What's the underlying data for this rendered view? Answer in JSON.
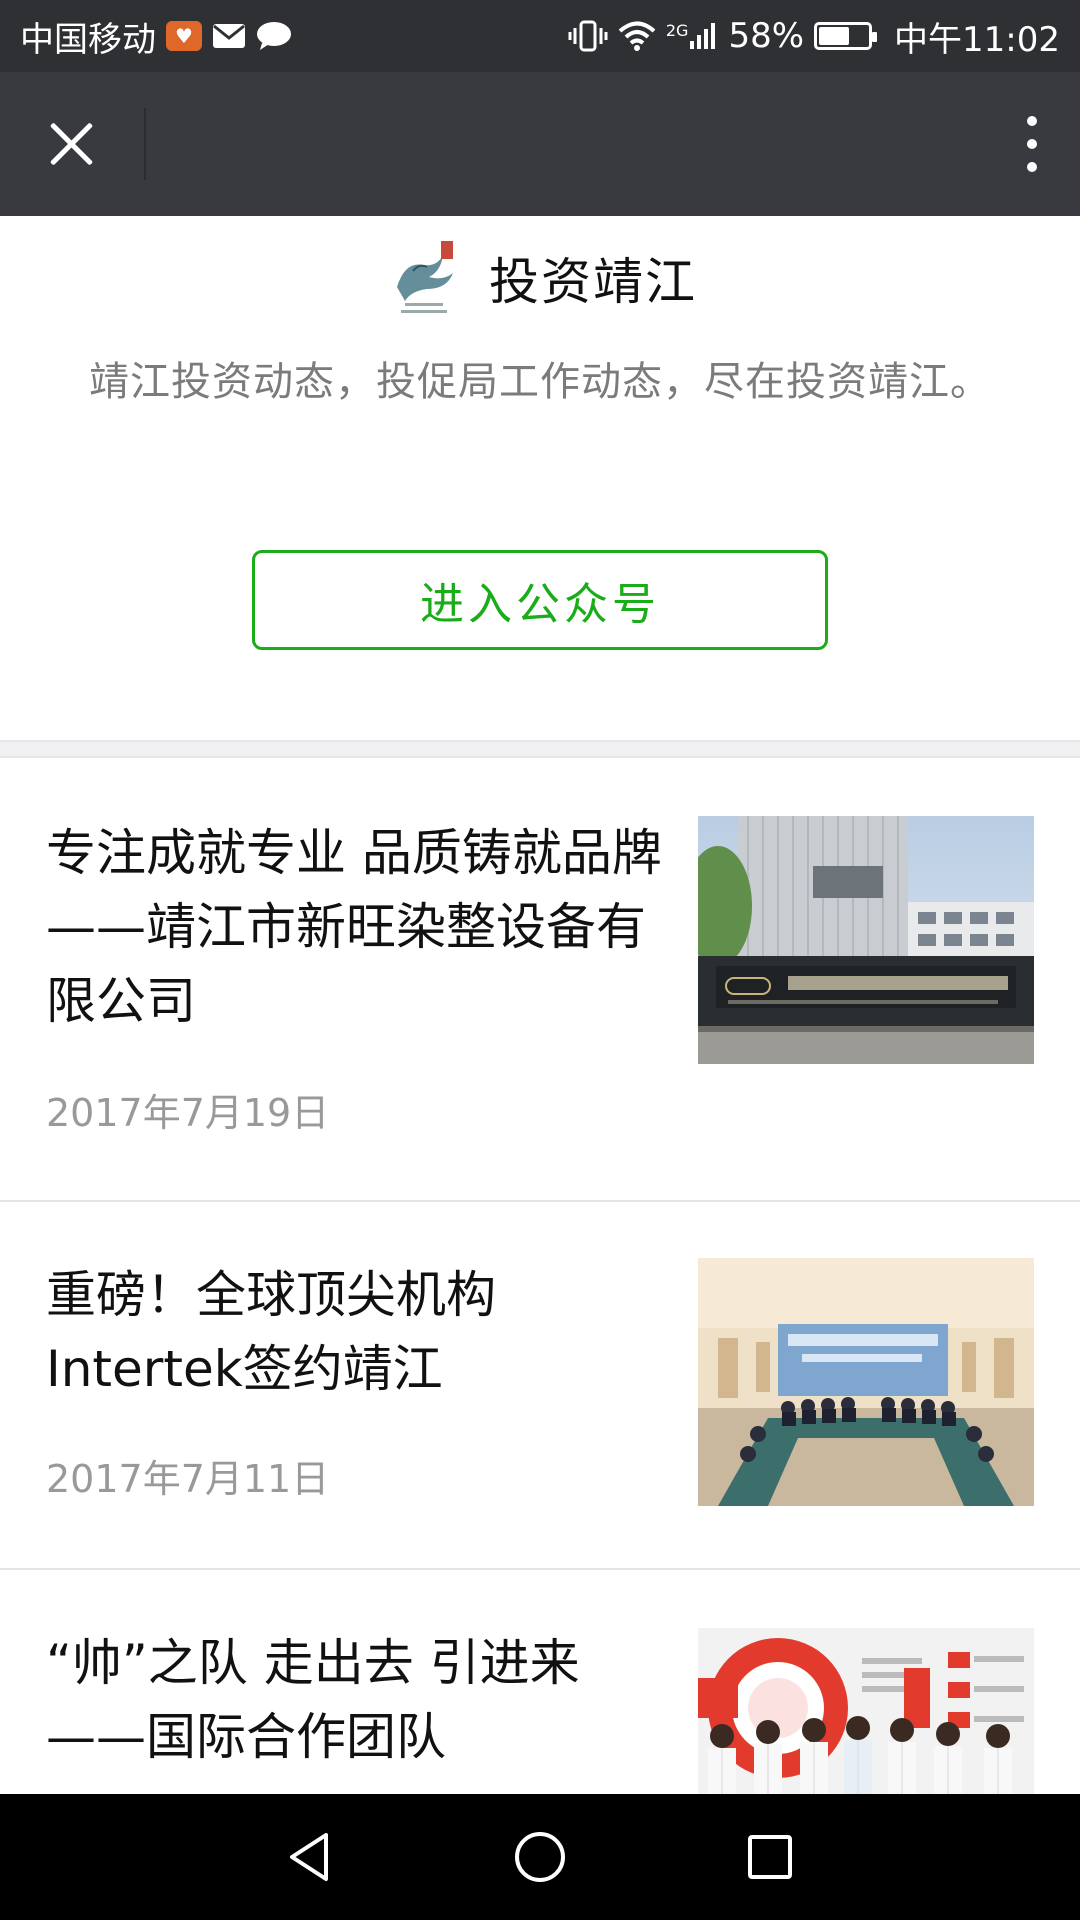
{
  "status_bar": {
    "carrier": "中国移动",
    "network": "2G",
    "battery": "58%",
    "battery_level": 0.58,
    "time": "中午11:02"
  },
  "top_bar": {
    "close_icon": "close-icon",
    "more_icon": "more-vertical-icon"
  },
  "account": {
    "name": "投资靖江",
    "description": "靖江投资动态，投促局工作动态，尽在投资靖江。",
    "enter_button": "进入公众号",
    "accent_color": "#1aad19"
  },
  "articles": [
    {
      "title": "专注成就专业 品质铸就品牌——靖江市新旺染整设备有限公司",
      "date": "2017年7月19日"
    },
    {
      "title": "重磅！全球顶尖机构Intertek签约靖江",
      "date": "2017年7月11日"
    },
    {
      "title": "“帅”之队 走出去 引进来——国际合作团队",
      "date": ""
    }
  ]
}
